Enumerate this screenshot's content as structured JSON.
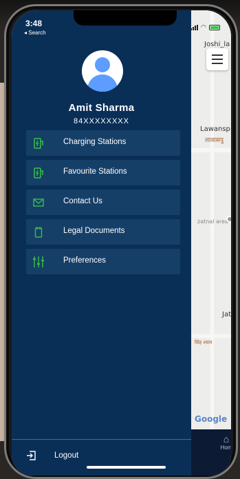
{
  "status_bar": {
    "time": "3:48",
    "back_label": "◂ Search"
  },
  "profile": {
    "name": "Amit Sharma",
    "phone": "84XXXXXXXX"
  },
  "menu": {
    "items": [
      {
        "label": "Charging Stations",
        "icon": "ev-station-icon"
      },
      {
        "label": "Favourite Stations",
        "icon": "ev-station-icon"
      },
      {
        "label": "Contact Us",
        "icon": "mail-icon"
      },
      {
        "label": "Legal Documents",
        "icon": "document-icon"
      },
      {
        "label": "Preferences",
        "icon": "sliders-icon"
      }
    ],
    "logout_label": "Logout"
  },
  "map": {
    "labels": {
      "joshi": "Joshi_la",
      "lawansp": "Lawansp",
      "lawansp_hindi": "लावासपु",
      "zatnal": "zatnal area",
      "jat": "Jat",
      "jat_hindi": "सिंह श्याम",
      "google": "Google"
    },
    "home_label": "Hom"
  },
  "colors": {
    "drawer_bg": "#0a2f57",
    "item_bg": "#163f68",
    "accent_green": "#37c144",
    "avatar_blue": "#5c9dff"
  }
}
